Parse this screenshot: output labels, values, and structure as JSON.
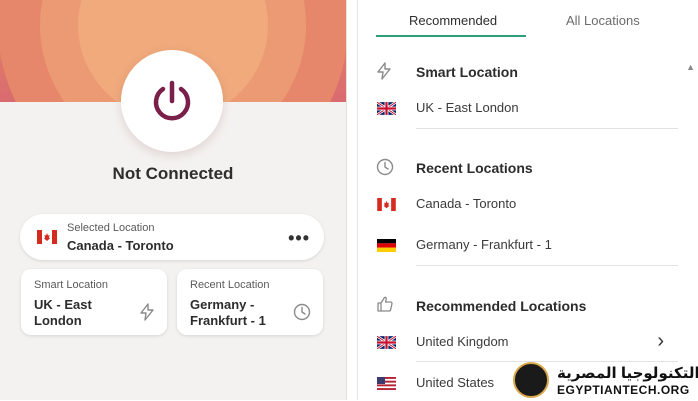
{
  "app": {
    "status": "Not Connected"
  },
  "selected_location": {
    "label": "Selected Location",
    "value": "Canada - Toronto",
    "more": "•••"
  },
  "smart_location_card": {
    "label": "Smart Location",
    "value_line1": "UK - East",
    "value_line2": "London"
  },
  "recent_location_card": {
    "label": "Recent Location",
    "value_line1": "Germany -",
    "value_line2": "Frankfurt - 1"
  },
  "tabs": [
    {
      "label": "Recommended",
      "active": true
    },
    {
      "label": "All Locations",
      "active": false
    }
  ],
  "sections": {
    "smart": {
      "title": "Smart Location",
      "items": [
        {
          "label": "UK - East London",
          "flag": "uk"
        }
      ]
    },
    "recent": {
      "title": "Recent Locations",
      "items": [
        {
          "label": "Canada - Toronto",
          "flag": "canada"
        },
        {
          "label": "Germany - Frankfurt - 1",
          "flag": "germany"
        }
      ]
    },
    "recommended": {
      "title": "Recommended Locations",
      "items": [
        {
          "label": "United Kingdom",
          "flag": "uk"
        },
        {
          "label": "United States",
          "flag": "us"
        }
      ]
    }
  },
  "watermark": {
    "arabic": "التكنولوجيا المصرية",
    "english": "EGYPTIANTECH.ORG"
  },
  "colors": {
    "accent_green": "#2f9e77",
    "power_icon": "#7a1f4a",
    "hero_orange": "#e98a63"
  }
}
